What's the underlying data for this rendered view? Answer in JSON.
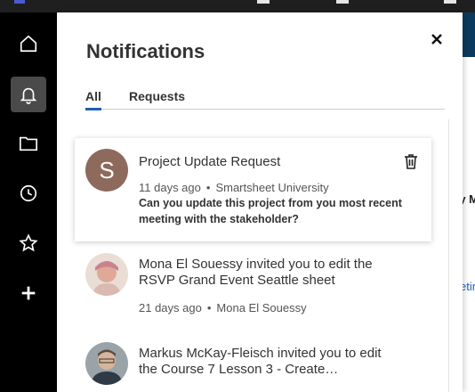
{
  "panel": {
    "title": "Notifications",
    "tabs": [
      {
        "label": "All",
        "active": true
      },
      {
        "label": "Requests",
        "active": false
      }
    ]
  },
  "rail": {
    "items": [
      {
        "icon": "home-icon"
      },
      {
        "icon": "bell-icon",
        "active": true
      },
      {
        "icon": "folder-icon"
      },
      {
        "icon": "clock-icon"
      },
      {
        "icon": "star-icon"
      },
      {
        "icon": "plus-icon"
      }
    ]
  },
  "notifications": [
    {
      "avatar_letter": "S",
      "avatar_color": "#8e6a5c",
      "title": "Project Update Request",
      "time": "11 days ago",
      "source": "Smartsheet University",
      "body": "Can you update this project from you most recent meeting with the stakeholder?"
    },
    {
      "title": "Mona El Souessy invited you to edit the RSVP Grand Event Seattle sheet",
      "time": "21 days ago",
      "source": "Mona El Souessy"
    },
    {
      "title": "Markus McKay-Fleisch invited you to edit the Course 7 Lesson 3 - Create…"
    }
  ],
  "background_app": {
    "fragment_1": "by M",
    "fragment_2": "etin"
  },
  "colors": {
    "rail": "#000000",
    "accent": "#1e60b3",
    "header_bar": "#0b3a5e"
  }
}
